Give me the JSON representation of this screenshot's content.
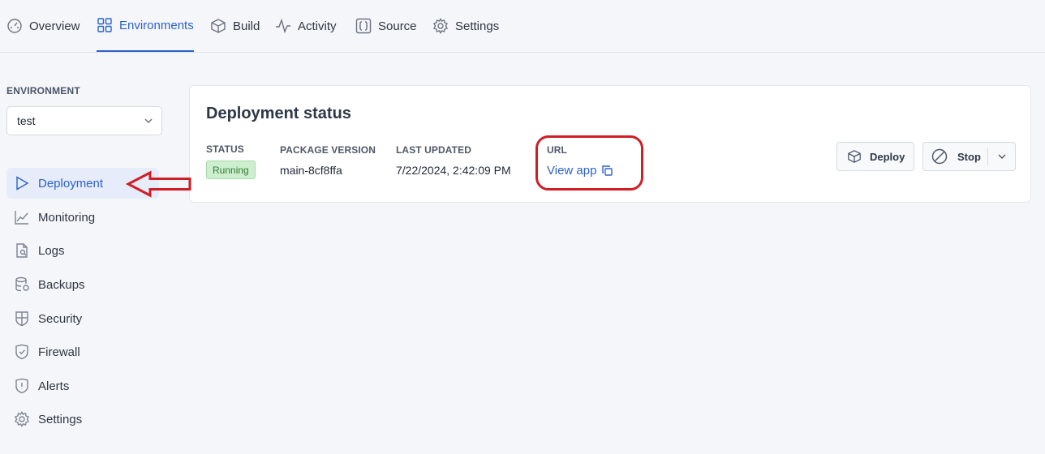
{
  "topnav": {
    "tabs": [
      {
        "label": "Overview",
        "icon": "dashboard-icon"
      },
      {
        "label": "Environments",
        "icon": "grid-icon",
        "active": true
      },
      {
        "label": "Build",
        "icon": "box-icon"
      },
      {
        "label": "Activity",
        "icon": "activity-icon"
      },
      {
        "label": "Source",
        "icon": "code-braces-icon"
      },
      {
        "label": "Settings",
        "icon": "gear-icon"
      }
    ]
  },
  "sidebar": {
    "environment_label": "ENVIRONMENT",
    "environment_value": "test",
    "items": [
      {
        "label": "Deployment",
        "icon": "play-icon",
        "active": true
      },
      {
        "label": "Monitoring",
        "icon": "chart-line-icon"
      },
      {
        "label": "Logs",
        "icon": "file-search-icon"
      },
      {
        "label": "Backups",
        "icon": "database-icon"
      },
      {
        "label": "Security",
        "icon": "shield-icon"
      },
      {
        "label": "Firewall",
        "icon": "shield-check-icon"
      },
      {
        "label": "Alerts",
        "icon": "shield-alert-icon"
      },
      {
        "label": "Settings",
        "icon": "gear-icon"
      }
    ]
  },
  "deployment": {
    "title": "Deployment status",
    "status_label": "STATUS",
    "status_value": "Running",
    "package_label": "PACKAGE VERSION",
    "package_value": "main-8cf8ffa",
    "updated_label": "LAST UPDATED",
    "updated_value": "7/22/2024, 2:42:09 PM",
    "url_label": "URL",
    "url_link": "View app",
    "deploy_button": "Deploy",
    "stop_button": "Stop"
  },
  "colors": {
    "accent": "#2b62c9",
    "running_bg": "#cdeecf",
    "running_text": "#2f7d33",
    "annotation": "#d01e24"
  }
}
